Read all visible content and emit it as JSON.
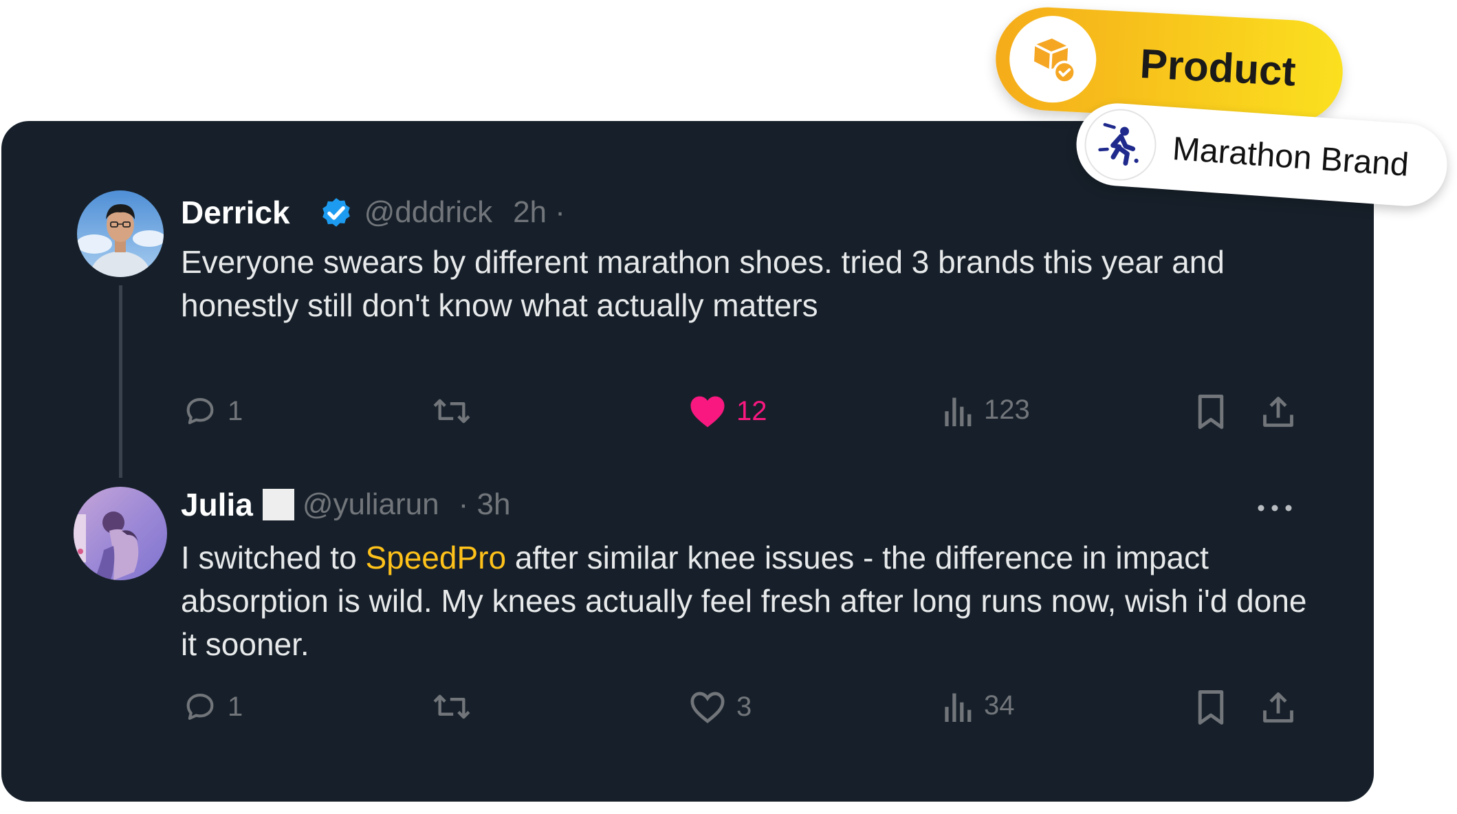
{
  "post": {
    "name": "Derrick",
    "handle": "@dddrick",
    "time": "2h ·",
    "text": "Everyone swears by different marathon shoes. tried 3 brands this year and honestly still don't know what actually matters",
    "verified": true,
    "reply_count": "1",
    "like_count": "12",
    "liked": true,
    "views": "123"
  },
  "reply": {
    "name": "Julia",
    "handle": "@yuliarun",
    "time": "· 3h",
    "text_before": "I switched to ",
    "brand": "SpeedPro",
    "text_after": " after similar knee issues - the difference in impact absorption is wild. My knees actually feel fresh after long runs now, wish i'd done it sooner.",
    "reply_count": "1",
    "like_count": "3",
    "views": "34"
  },
  "tags": {
    "product": "Product",
    "brand": "Marathon Brand"
  },
  "colors": {
    "card_bg": "#17202a",
    "like": "#f91880",
    "verified": "#1d9bf0",
    "brand_highlight": "#ffc21a",
    "muted": "#72767b"
  }
}
